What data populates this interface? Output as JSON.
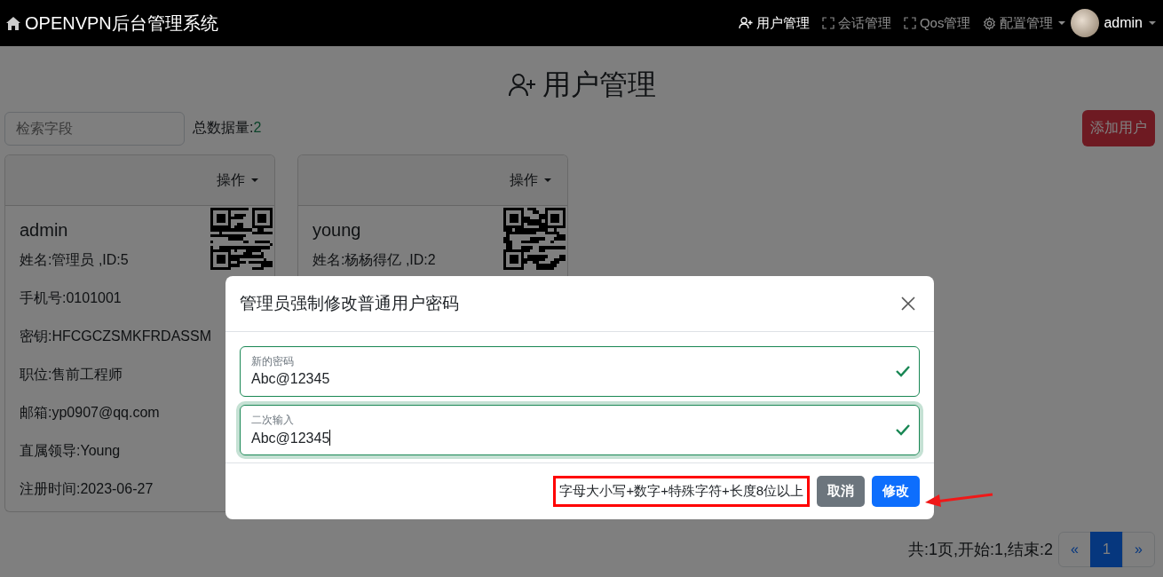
{
  "navbar": {
    "brand": "OPENVPN后台管理系统",
    "items": [
      {
        "label": "用户管理",
        "kind": "people",
        "selected": true,
        "dropdown": false
      },
      {
        "label": "会话管理",
        "kind": "session",
        "selected": false,
        "dropdown": false
      },
      {
        "label": "Qos管理",
        "kind": "session",
        "selected": false,
        "dropdown": false
      },
      {
        "label": "配置管理",
        "kind": "config",
        "selected": false,
        "dropdown": true
      }
    ],
    "user": "admin"
  },
  "page_title": "用户管理",
  "search": {
    "placeholder": "检索字段"
  },
  "total": {
    "label": "总数据量:",
    "value": "2"
  },
  "add_button": "添加用户",
  "cards": [
    {
      "menu": "操作",
      "username": "admin",
      "fields": [
        "姓名:管理员 ,ID:5",
        "手机号:0101001",
        "密钥:HFCGCZSMKFRDASSM",
        "职位:售前工程师",
        "邮箱:yp0907@qq.com",
        "直属领导:Young",
        "注册时间:2023-06-27"
      ]
    },
    {
      "menu": "操作",
      "username": "young",
      "fields": [
        "姓名:杨杨得亿 ,ID:2"
      ]
    }
  ],
  "pagination": {
    "summary": "共:1页,开始:1,结束:2",
    "pages": [
      {
        "label": "«",
        "selected": false
      },
      {
        "label": "1",
        "selected": true
      },
      {
        "label": "»",
        "selected": false
      }
    ]
  },
  "modal": {
    "title": "管理员强制修改普通用户密码",
    "fields": [
      {
        "label": "新的密码",
        "value": "Abc@12345",
        "valid": true,
        "focused": false
      },
      {
        "label": "二次输入",
        "value": "Abc@12345",
        "valid": true,
        "focused": true
      }
    ],
    "hint": "字母大小写+数字+特殊字符+长度8位以上",
    "cancel": "取消",
    "submit": "修改"
  }
}
